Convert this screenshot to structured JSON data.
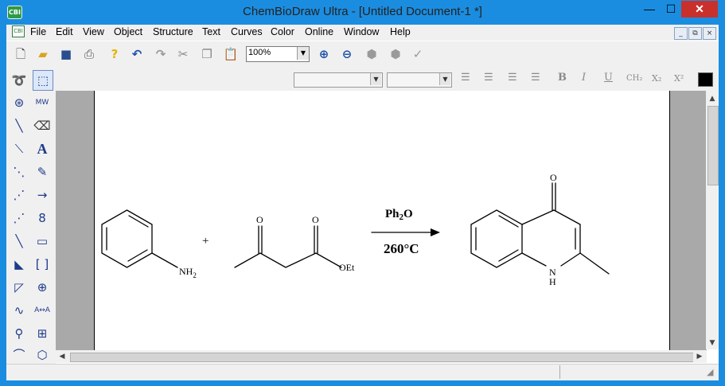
{
  "window": {
    "app_icon": "CBI",
    "title": "ChemBioDraw Ultra - [Untitled Document-1 *]",
    "min_glyph": "—",
    "max_glyph": "☐",
    "close_glyph": "✕"
  },
  "menu": {
    "doc_icon": "CBI",
    "items": [
      "File",
      "Edit",
      "View",
      "Object",
      "Structure",
      "Text",
      "Curves",
      "Color",
      "Online",
      "Window",
      "Help"
    ],
    "mdi_buttons": [
      "_",
      "⧉",
      "×"
    ]
  },
  "toolbar": {
    "icons": [
      "new-document-icon",
      "open-folder-icon",
      "save-icon",
      "print-icon",
      "help-icon",
      "undo-icon",
      "redo-icon",
      "cut-icon",
      "copy-icon",
      "paste-icon",
      "zoom-in-icon",
      "zoom-out-icon",
      "clean-structure-icon",
      "check-structure-icon",
      "checkmark-icon"
    ],
    "zoom_value": "100%"
  },
  "style_toolbar": {
    "bold": "B",
    "italic": "I",
    "underline": "U",
    "formula": "CH₂",
    "subscript": "X₂",
    "superscript": "X²",
    "color": "#000000"
  },
  "palette": {
    "tools": [
      "lasso-icon",
      "marquee-select-icon",
      "structure-perspective-icon",
      "mass-fragment-icon",
      "single-bond-icon",
      "eraser-icon",
      "wedge-bond-icon",
      "text-tool-icon",
      "hashed-bond-icon",
      "pen-tool-icon",
      "bold-hashed-bond-icon",
      "arrow-tool-icon",
      "dashed-bond-icon",
      "orbital-icon",
      "bold-bond-icon",
      "drawing-element-icon",
      "wedged-bold-bond-icon",
      "bracket-icon",
      "hollow-wedge-bond-icon",
      "chemical-symbol-icon",
      "wavy-bond-icon",
      "reaction-atom-map-icon",
      "query-tool-icon",
      "table-tool-icon",
      "chain-tool-icon",
      "templates-icon"
    ],
    "text_a": "A",
    "text_mw": "MW",
    "text_map": "A↔A"
  },
  "reaction": {
    "reactant1_nh2": "NH",
    "reactant1_sub": "2",
    "plus": "+",
    "reactant2_o1": "O",
    "reactant2_o2": "O",
    "reactant2_oet": "OEt",
    "reagent": "Ph",
    "reagent_sub": "2",
    "reagent_o": "O",
    "condition": "260°C",
    "product_o": "O",
    "product_n": "N",
    "product_h": "H"
  }
}
